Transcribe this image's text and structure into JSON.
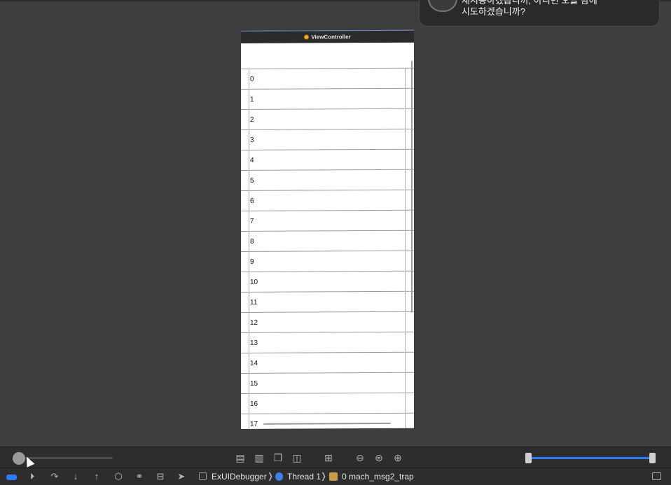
{
  "notification": {
    "line1": "재시동하겠습니까, 아니면 오늘 밤에",
    "line2": "시도하겠습니까?"
  },
  "device": {
    "title": "ViewController",
    "rows": [
      "0",
      "1",
      "2",
      "3",
      "4",
      "5",
      "6",
      "7",
      "8",
      "9",
      "10",
      "11",
      "12",
      "13",
      "14",
      "15",
      "16",
      "17"
    ]
  },
  "toolbar": {
    "view_buttons": [
      "show-clipped-icon",
      "show-constraints-icon",
      "change-canvas-icon",
      "wireframe-icon"
    ],
    "zoom": [
      "zoom-out-icon",
      "zoom-actual-icon",
      "zoom-in-icon"
    ],
    "range_slider": {
      "low": 0.0,
      "high": 1.0
    }
  },
  "debugbar": {
    "breadcrumb": {
      "app": "ExUIDebugger",
      "thread": "Thread 1",
      "frame": "0 mach_msg2_trap"
    }
  },
  "colors": {
    "accent": "#2f7df6",
    "canvas": "#3e3e3e",
    "bar": "#2d2d2d"
  }
}
